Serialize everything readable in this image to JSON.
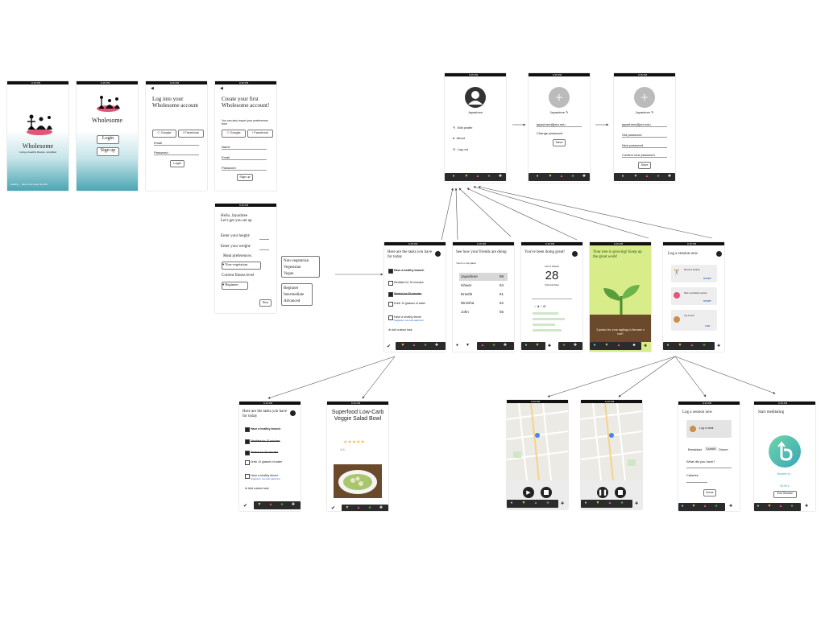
{
  "status_time": "9:15 PM",
  "status_battery": "100%",
  "splash": {
    "title": "Wholesome",
    "tagline": "Living a healthy lifestyle, simplified",
    "loading": "loading.... take a few deep breaths"
  },
  "home": {
    "title": "Wholesome",
    "login": "Login",
    "signup": "Sign up"
  },
  "login": {
    "heading": "Log into your Wholesome account",
    "google": "Google",
    "facebook": "Facebook",
    "email": "Email",
    "password": "Password",
    "button": "Login"
  },
  "create": {
    "heading": "Create your first Wholesome account!",
    "sub": "You can also import your preferences from",
    "google": "Google",
    "facebook": "Facebook",
    "name": "Name",
    "email": "Email",
    "password": "Password",
    "button": "Sign up"
  },
  "setup": {
    "greeting": "Hello, Jayashree",
    "sub": "Let's get you set up",
    "height": "Enter your height:",
    "weight": "Enter your weight:",
    "meal_label": "Meal preferences:",
    "meal_value": "Non-vegetarian",
    "fitness_label": "Current fitness level",
    "fitness_value": "Beginner",
    "next": "Next",
    "meal_options": [
      "Non-vegetarian",
      "Vegetarian",
      "Vegan"
    ],
    "fitness_options": [
      "Beginner",
      "Intermediate",
      "Advanced"
    ]
  },
  "profile": {
    "name": "Jayashree",
    "edit": "Edit profile",
    "about": "About",
    "logout": "Log out"
  },
  "profile2": {
    "name": "Jayashree",
    "email": "jayashree@jam.edu",
    "change": "Change password",
    "save": "Save"
  },
  "profile3": {
    "name": "Jayashree",
    "email": "jayashree@jam.edu",
    "old": "Old password",
    "new": "New password",
    "confirm": "Confirm new password",
    "save": "Save"
  },
  "tasks": {
    "heading": "Here are the tasks you have for today",
    "items": [
      "Have a healthy brunch",
      "Meditate for 15 minutes",
      "Stretch for 30 minutes",
      "Drink 10 glasses of water",
      "Have a healthy dinner"
    ],
    "suggestion": "Suggestion: Low carb salad bowl",
    "add": "Add custom task"
  },
  "friends": {
    "heading": "See how your friends are doing",
    "sub": "You're in 1st place!",
    "rows": [
      {
        "name": "Jayashree",
        "score": "98"
      },
      {
        "name": "Ishwar",
        "score": "94"
      },
      {
        "name": "Drashti",
        "score": "81"
      },
      {
        "name": "Nimisha",
        "score": "62"
      },
      {
        "name": "John",
        "score": "55"
      }
    ]
  },
  "streak": {
    "heading": "You've been doing great!",
    "label": "Last 4 Weeks",
    "value": "28",
    "sub": "Total Gold Stars"
  },
  "tree": {
    "heading": "Your tree is growing! Keep up the great work!",
    "note": "2 points for your sapling to become a tree!"
  },
  "log": {
    "heading": "Log a session now",
    "cards": [
      {
        "text": "Record a workout",
        "action": "START"
      },
      {
        "text": "Start a meditation session",
        "action": "START"
      },
      {
        "text": "Log a meal",
        "action": "LOG"
      }
    ]
  },
  "recipe": {
    "title": "Superfood Low-Carb Veggie Salad Bowl",
    "rating": "4.8"
  },
  "meal": {
    "heading": "Log a session now",
    "log_meal": "Log a meal",
    "tabs": [
      "Breakfast",
      "Lunch",
      "Dinner"
    ],
    "question": "What did you have?",
    "calories": "Calories",
    "done": "Done"
  },
  "meditate": {
    "heading": "Start meditating",
    "breathe": "Breathe in...",
    "timer": "03:05 s",
    "end": "End Session"
  },
  "colors": {
    "teal": "#4aa6b3",
    "pink": "#e0577a",
    "green_bg": "#d9ec8a",
    "green_plant": "#5a9e3c"
  }
}
